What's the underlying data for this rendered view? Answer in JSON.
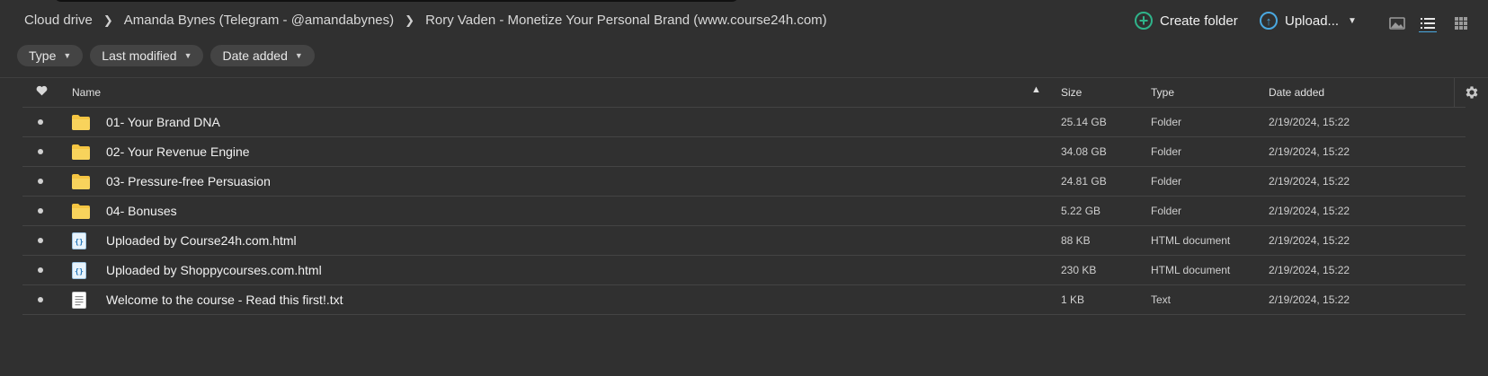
{
  "breadcrumb": [
    {
      "label": "Cloud drive"
    },
    {
      "label": "Amanda Bynes (Telegram - @amandabynes)"
    },
    {
      "label": "Rory Vaden - Monetize Your Personal Brand (www.course24h.com)"
    }
  ],
  "actions": {
    "create_folder": "Create folder",
    "upload": "Upload..."
  },
  "filters": [
    "Type",
    "Last modified",
    "Date added"
  ],
  "table": {
    "columns": {
      "name": "Name",
      "size": "Size",
      "type": "Type",
      "date": "Date added"
    },
    "rows": [
      {
        "name": "01- Your Brand DNA",
        "size": "25.14 GB",
        "type": "Folder",
        "date": "2/19/2024, 15:22",
        "icon": "folder"
      },
      {
        "name": "02- Your Revenue Engine",
        "size": "34.08 GB",
        "type": "Folder",
        "date": "2/19/2024, 15:22",
        "icon": "folder"
      },
      {
        "name": "03- Pressure-free Persuasion",
        "size": "24.81 GB",
        "type": "Folder",
        "date": "2/19/2024, 15:22",
        "icon": "folder"
      },
      {
        "name": "04- Bonuses",
        "size": "5.22 GB",
        "type": "Folder",
        "date": "2/19/2024, 15:22",
        "icon": "folder"
      },
      {
        "name": "Uploaded by Course24h.com.html",
        "size": "88 KB",
        "type": "HTML document",
        "date": "2/19/2024, 15:22",
        "icon": "html"
      },
      {
        "name": "Uploaded by Shoppycourses.com.html",
        "size": "230 KB",
        "type": "HTML document",
        "date": "2/19/2024, 15:22",
        "icon": "html"
      },
      {
        "name": "Welcome to the course - Read this first!.txt",
        "size": "1 KB",
        "type": "Text",
        "date": "2/19/2024, 15:22",
        "icon": "text"
      }
    ]
  },
  "colors": {
    "background": "#303030",
    "folder": "#f5c542",
    "accent_green": "#2fb38a",
    "accent_blue": "#4aa8e0"
  }
}
